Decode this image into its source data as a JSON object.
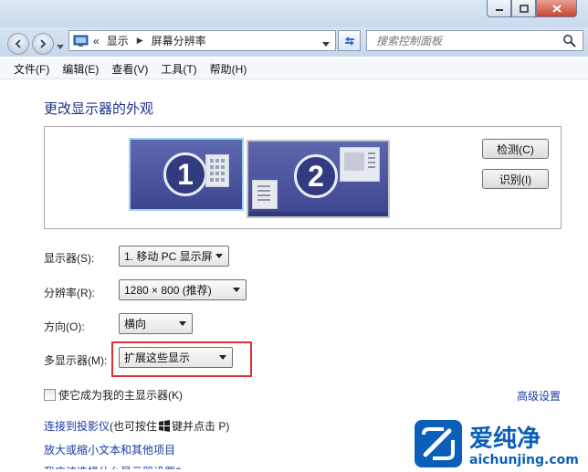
{
  "window": {
    "minimize_icon": "minimize-icon",
    "maximize_icon": "maximize-icon",
    "close_icon": "close-icon"
  },
  "nav": {
    "breadcrumb_prefix": "«",
    "breadcrumb": [
      "显示",
      "屏幕分辨率"
    ],
    "search_placeholder": "搜索控制面板"
  },
  "menu": [
    "文件(F)",
    "编辑(E)",
    "查看(V)",
    "工具(T)",
    "帮助(H)"
  ],
  "page": {
    "title": "更改显示器的外观",
    "monitors": [
      "1",
      "2"
    ],
    "detect_button": "检测(C)",
    "identify_button": "识别(I)"
  },
  "fields": {
    "display_label": "显示器(S):",
    "display_value": "1. 移动 PC 显示屏",
    "resolution_label": "分辨率(R):",
    "resolution_value": "1280 × 800 (推荐)",
    "orientation_label": "方向(O):",
    "orientation_value": "横向",
    "multi_label": "多显示器(M):",
    "multi_value": "扩展这些显示"
  },
  "primary_checkbox": {
    "label": "使它成为我的主显示器(K)",
    "checked": false
  },
  "advanced_link": "高级设置",
  "links": [
    {
      "text_before": "连接到投影仪",
      "text_after_link": " (也可按住 ",
      "key_after_icon": " 键并点击 P)"
    },
    {
      "text": "放大或缩小文本和其他项目"
    },
    {
      "text": "我应该选择什么显示器设置?"
    }
  ],
  "watermark": {
    "brand": "爱纯净",
    "url": "aichunjing.com"
  },
  "colors": {
    "accent_title": "#1e3287",
    "link": "#1a3aa6",
    "highlight_border": "#e03034"
  }
}
